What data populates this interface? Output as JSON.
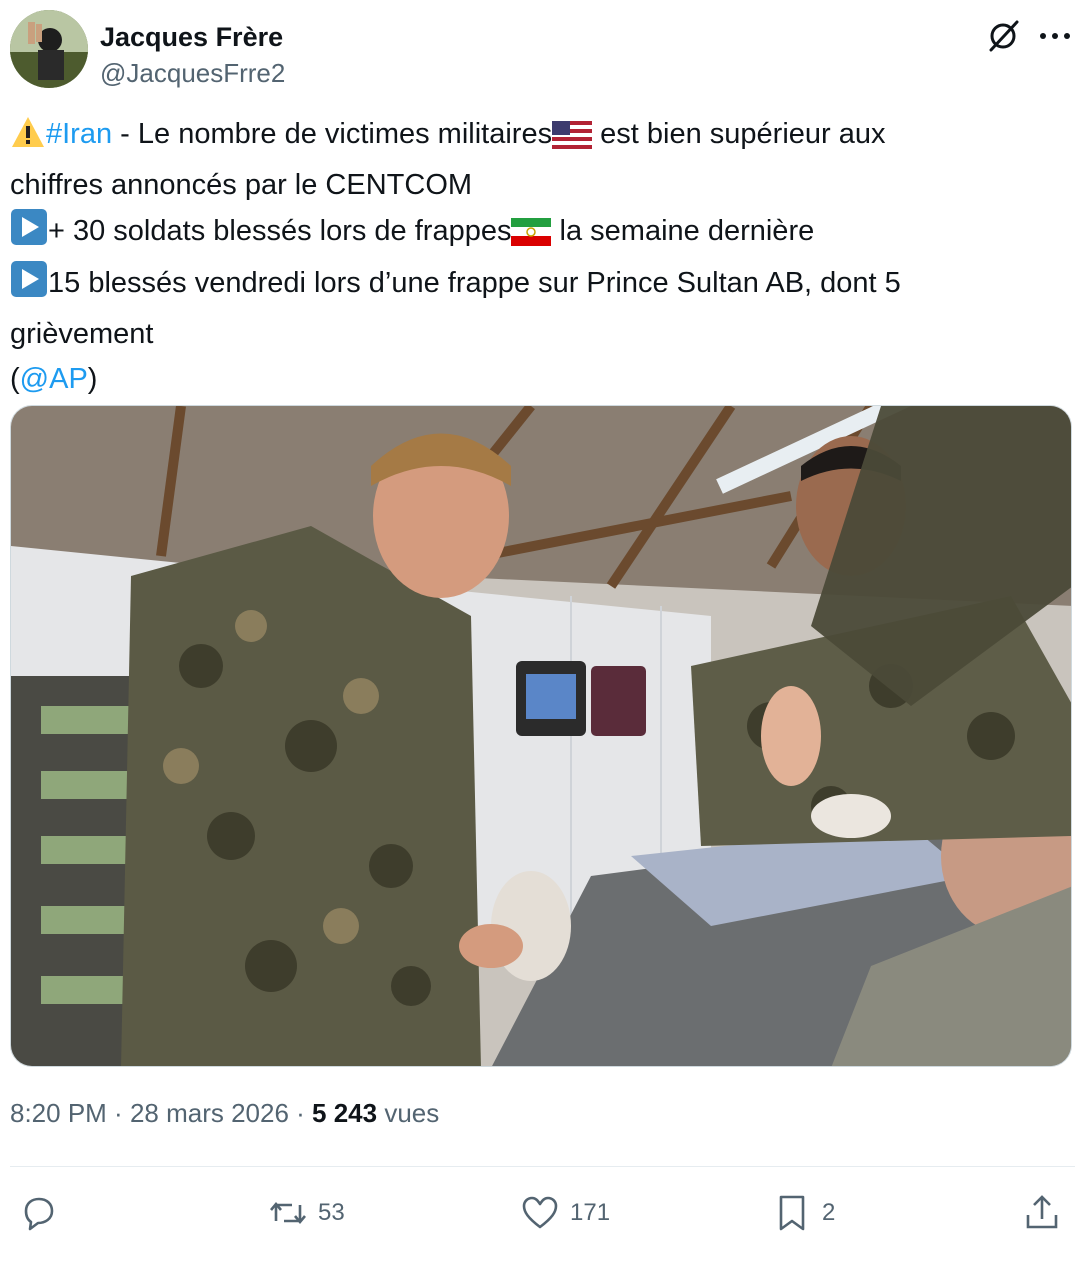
{
  "author": {
    "name": "Jacques Frère",
    "handle": "@JacquesFrre2"
  },
  "tweet": {
    "lines": [
      {
        "warning_icon": "warning-icon",
        "hashtag": "#Iran",
        "text_a": " - Le nombre de victimes militaires",
        "flag": "us-flag",
        "text_b": " est bien supérieur aux"
      },
      {
        "text": "chiffres annoncés par le CENTCOM"
      },
      {
        "bullet_icon": "play-button-icon",
        "text_a": "+ 30 soldats blessés lors de frappes",
        "flag": "iran-flag",
        "text_b": " la semaine dernière"
      },
      {
        "bullet_icon": "play-button-icon",
        "text": "15 blessés vendredi lors d’une frappe sur Prince Sultan AB, dont 5"
      },
      {
        "text": "grièvement"
      },
      {
        "open": "(",
        "mention": "@AP",
        "close": ")"
      }
    ]
  },
  "media": {
    "alt": "Photo: Marines treating a wounded service member in a medical tent"
  },
  "meta": {
    "time": "8:20 PM",
    "sep1": " · ",
    "date": "28 mars 2026",
    "sep2": " · ",
    "views_count": "5 243",
    "views_label": " vues"
  },
  "actions": {
    "reply_count": "",
    "retweet_count": "53",
    "like_count": "171",
    "bookmark_count": "2"
  },
  "colors": {
    "link": "#1d9bf0",
    "secondary_text": "#536471",
    "primary_text": "#0f1419"
  }
}
